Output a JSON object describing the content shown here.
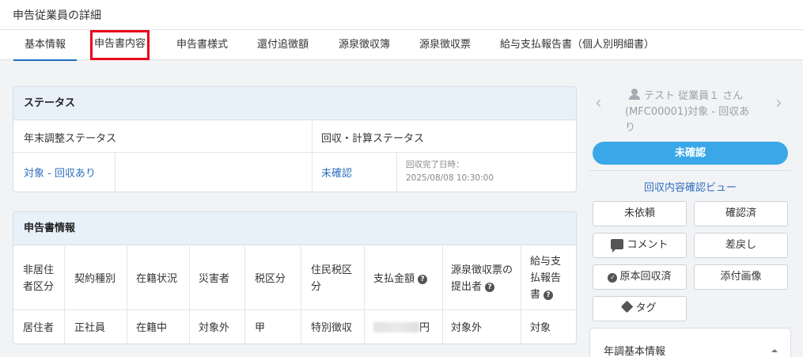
{
  "page_title": "申告従業員の詳細",
  "tabs": [
    {
      "label": "基本情報",
      "active": true
    },
    {
      "label": "申告書内容",
      "highlighted": true
    },
    {
      "label": "申告書様式"
    },
    {
      "label": "還付追徴額"
    },
    {
      "label": "源泉徴収簿"
    },
    {
      "label": "源泉徴収票"
    },
    {
      "label": "給与支払報告書（個人別明細書）"
    }
  ],
  "status_card": {
    "title": "ステータス",
    "col1_header": "年末調整ステータス",
    "col2_header": "回収・計算ステータス",
    "year_end_status": "対象 - 回収あり",
    "calc_status": "未確認",
    "collected_at_label": "回収完了日時：",
    "collected_at": "2025/08/08 10:30:00"
  },
  "declaration_card": {
    "title": "申告書情報",
    "headers": [
      {
        "label": "非居住者区分"
      },
      {
        "label": "契約種別"
      },
      {
        "label": "在籍状況"
      },
      {
        "label": "災害者"
      },
      {
        "label": "税区分"
      },
      {
        "label": "住民税区分"
      },
      {
        "label": "支払金額",
        "help": true
      },
      {
        "label": "源泉徴収票の提出者",
        "help": true
      },
      {
        "label": "給与支払報告書",
        "help": true
      }
    ],
    "row": {
      "residency": "居住者",
      "contract": "正社員",
      "employment": "在籍中",
      "disaster": "対象外",
      "tax_class": "甲",
      "resident_tax": "特別徴収",
      "payment_suffix": "円",
      "withholding_submitter": "対象外",
      "payroll_report": "対象"
    }
  },
  "right_panel": {
    "user_line1": "テスト 従業員１ さん",
    "user_line2": "(MFC00001)対象 - 回収あ",
    "user_line3": "り",
    "prev_arrow": "‹",
    "next_arrow": "›",
    "status_label": "未確認",
    "review_view_link": "回収内容確認ビュー",
    "buttons": {
      "not_requested": "未依頼",
      "confirmed": "確認済",
      "comment": "コメント",
      "send_back": "差戻し",
      "original_collected": "原本回収済",
      "attachment": "添付画像",
      "tag": "タグ"
    },
    "basic_info_section": "年調基本情報"
  },
  "colors": {
    "accent": "#1f6fbf",
    "link": "#2f6fbf",
    "status_pill": "#3aa8e8",
    "highlight_box": "#e8001c",
    "card_header_bg": "#e8f0fa"
  },
  "icons": [
    "user-icon",
    "chevron-left-icon",
    "chevron-right-icon",
    "help-icon",
    "comment-icon",
    "check-circle-icon",
    "tag-icon",
    "caret-up-icon"
  ]
}
